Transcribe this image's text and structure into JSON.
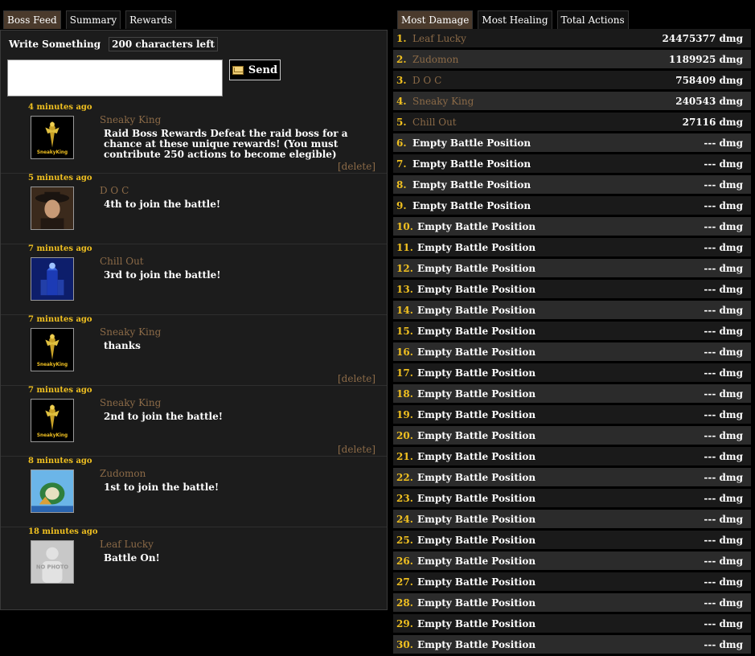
{
  "left_tabs": [
    "Boss Feed",
    "Summary",
    "Rewards"
  ],
  "right_tabs": [
    "Most Damage",
    "Most Healing",
    "Total Actions"
  ],
  "compose": {
    "label": "Write Something",
    "chars_left": "200 characters left",
    "send_label": "Send",
    "textarea_value": ""
  },
  "feed": [
    {
      "time": "4 minutes ago",
      "poster": "Sneaky King",
      "message": "Raid Boss Rewards Defeat the raid boss for a chance at these unique rewards! (You must contribute 250 actions to become elegible)",
      "delete": "[delete]",
      "avatar": "sneaky-king-avatar"
    },
    {
      "time": "5 minutes ago",
      "poster": "D O C",
      "message": "4th to join the battle!",
      "delete": "",
      "avatar": "doc-avatar"
    },
    {
      "time": "7 minutes ago",
      "poster": "Chill Out",
      "message": "3rd to join the battle!",
      "delete": "",
      "avatar": "chill-out-avatar"
    },
    {
      "time": "7 minutes ago",
      "poster": "Sneaky King",
      "message": "thanks",
      "delete": "[delete]",
      "avatar": "sneaky-king-avatar"
    },
    {
      "time": "7 minutes ago",
      "poster": "Sneaky King",
      "message": "2nd to join the battle!",
      "delete": "[delete]",
      "avatar": "sneaky-king-avatar"
    },
    {
      "time": "8 minutes ago",
      "poster": "Zudomon",
      "message": "1st to join the battle!",
      "delete": "",
      "avatar": "zudomon-avatar"
    },
    {
      "time": "18 minutes ago",
      "poster": "Leaf Lucky",
      "message": "Battle On!",
      "delete": "",
      "avatar": "no-photo-avatar"
    }
  ],
  "leaderboard": [
    {
      "rank": "1.",
      "name": "Leaf Lucky",
      "dmg": "24475377 dmg",
      "empty": false
    },
    {
      "rank": "2.",
      "name": "Zudomon",
      "dmg": "1189925 dmg",
      "empty": false
    },
    {
      "rank": "3.",
      "name": "D O C",
      "dmg": "758409 dmg",
      "empty": false
    },
    {
      "rank": "4.",
      "name": "Sneaky King",
      "dmg": "240543 dmg",
      "empty": false
    },
    {
      "rank": "5.",
      "name": "Chill Out",
      "dmg": "27116 dmg",
      "empty": false
    },
    {
      "rank": "6.",
      "name": "Empty Battle Position",
      "dmg": "--- dmg",
      "empty": true
    },
    {
      "rank": "7.",
      "name": "Empty Battle Position",
      "dmg": "--- dmg",
      "empty": true
    },
    {
      "rank": "8.",
      "name": "Empty Battle Position",
      "dmg": "--- dmg",
      "empty": true
    },
    {
      "rank": "9.",
      "name": "Empty Battle Position",
      "dmg": "--- dmg",
      "empty": true
    },
    {
      "rank": "10.",
      "name": "Empty Battle Position",
      "dmg": "--- dmg",
      "empty": true
    },
    {
      "rank": "11.",
      "name": "Empty Battle Position",
      "dmg": "--- dmg",
      "empty": true
    },
    {
      "rank": "12.",
      "name": "Empty Battle Position",
      "dmg": "--- dmg",
      "empty": true
    },
    {
      "rank": "13.",
      "name": "Empty Battle Position",
      "dmg": "--- dmg",
      "empty": true
    },
    {
      "rank": "14.",
      "name": "Empty Battle Position",
      "dmg": "--- dmg",
      "empty": true
    },
    {
      "rank": "15.",
      "name": "Empty Battle Position",
      "dmg": "--- dmg",
      "empty": true
    },
    {
      "rank": "16.",
      "name": "Empty Battle Position",
      "dmg": "--- dmg",
      "empty": true
    },
    {
      "rank": "17.",
      "name": "Empty Battle Position",
      "dmg": "--- dmg",
      "empty": true
    },
    {
      "rank": "18.",
      "name": "Empty Battle Position",
      "dmg": "--- dmg",
      "empty": true
    },
    {
      "rank": "19.",
      "name": "Empty Battle Position",
      "dmg": "--- dmg",
      "empty": true
    },
    {
      "rank": "20.",
      "name": "Empty Battle Position",
      "dmg": "--- dmg",
      "empty": true
    },
    {
      "rank": "21.",
      "name": "Empty Battle Position",
      "dmg": "--- dmg",
      "empty": true
    },
    {
      "rank": "22.",
      "name": "Empty Battle Position",
      "dmg": "--- dmg",
      "empty": true
    },
    {
      "rank": "23.",
      "name": "Empty Battle Position",
      "dmg": "--- dmg",
      "empty": true
    },
    {
      "rank": "24.",
      "name": "Empty Battle Position",
      "dmg": "--- dmg",
      "empty": true
    },
    {
      "rank": "25.",
      "name": "Empty Battle Position",
      "dmg": "--- dmg",
      "empty": true
    },
    {
      "rank": "26.",
      "name": "Empty Battle Position",
      "dmg": "--- dmg",
      "empty": true
    },
    {
      "rank": "27.",
      "name": "Empty Battle Position",
      "dmg": "--- dmg",
      "empty": true
    },
    {
      "rank": "28.",
      "name": "Empty Battle Position",
      "dmg": "--- dmg",
      "empty": true
    },
    {
      "rank": "29.",
      "name": "Empty Battle Position",
      "dmg": "--- dmg",
      "empty": true
    },
    {
      "rank": "30.",
      "name": "Empty Battle Position",
      "dmg": "--- dmg",
      "empty": true
    }
  ],
  "avatar_texts": {
    "no_photo": "NO PHOTO",
    "sneaky_logo": "SneakyKing"
  },
  "colors": {
    "accent_gold": "#f0c020",
    "poster_brown": "#8b6a47",
    "active_tab": "#4a3a2c"
  }
}
